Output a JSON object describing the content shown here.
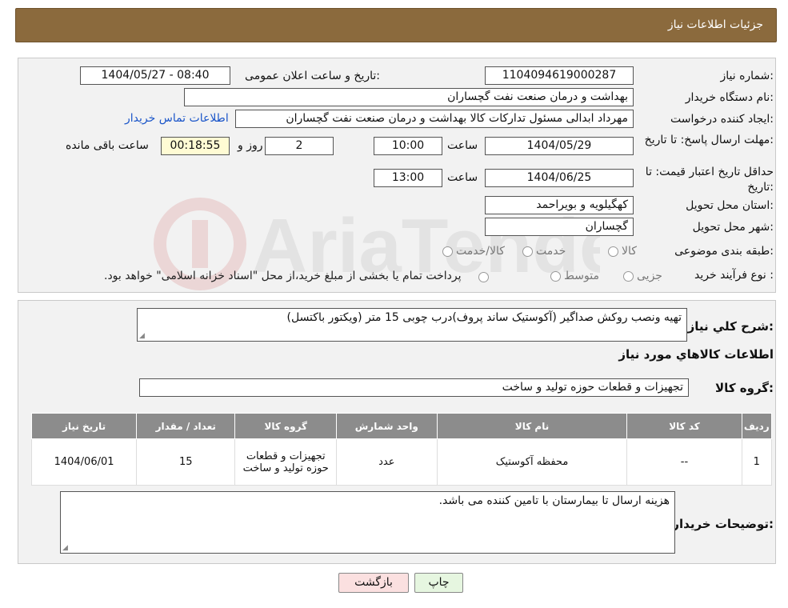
{
  "header": {
    "title": "جزئیات اطلاعات نیاز"
  },
  "form": {
    "need_number_label": "شماره نیاز:",
    "need_number": "1104094619000287",
    "announce_label": "تاریخ و ساعت اعلان عمومی:",
    "announce_value": "1404/05/27 - 08:40",
    "buyer_label": "نام دستگاه خریدار:",
    "buyer_value": "بهداشت و درمان صنعت نفت گچساران",
    "creator_label": "ایجاد کننده درخواست:",
    "creator_value": "مهرداد ابدالی مسئول تدارکات کالا  بهداشت و درمان صنعت نفت گچساران",
    "contact_link": "اطلاعات تماس خریدار",
    "deadline_label": "مهلت ارسال پاسخ: تا تاریخ:",
    "deadline_date": "1404/05/29",
    "time_label": "ساعت",
    "deadline_time": "10:00",
    "days_value": "2",
    "days_label": "روز و",
    "remaining_time": "00:18:55",
    "remaining_label": "ساعت باقی مانده",
    "validity_label": "حداقل تاریخ اعتبار قیمت: تا تاریخ:",
    "validity_date": "1404/06/25",
    "validity_time": "13:00",
    "province_label": "استان محل تحویل:",
    "province_value": "کهگیلویه و بویراحمد",
    "city_label": "شهر محل تحویل:",
    "city_value": "گچساران",
    "category_label": "طبقه بندی موضوعی:",
    "category_options": [
      "کالا",
      "خدمت",
      "کالا/خدمت"
    ],
    "process_label": "نوع فرآیند خرید :",
    "process_options": [
      "جزیی",
      "متوسط"
    ],
    "process_note": "پرداخت تمام یا بخشی از مبلغ خرید،از محل \"اسناد خزانه اسلامی\" خواهد بود."
  },
  "details": {
    "summary_label": "شرح کلي نياز:",
    "summary_value": "تهیه ونصب روکش صداگیر (آکوستیک ساند پروف)درب چوبی 15 متر (ویکتور باکتسل)",
    "goods_info_title": "اطلاعات کالاهاي مورد نياز",
    "goods_group_label": "گروه کالا:",
    "goods_group_value": "تجهیزات و قطعات حوزه تولید و ساخت",
    "table": {
      "headers": [
        "رديف",
        "کد کالا",
        "نام کالا",
        "واحد شمارش",
        "گروه کالا",
        "تعداد / مقدار",
        "تاريخ نياز"
      ],
      "rows": [
        [
          "1",
          "--",
          "محفظه آکوستیک",
          "عدد",
          "تجهیزات و قطعات حوزه تولید و ساخت",
          "15",
          "1404/06/01"
        ]
      ]
    },
    "buyer_notes_label": "توضیحات خریدار:",
    "buyer_notes_value": "هزینه ارسال تا بیمارستان با تامین کننده می باشد."
  },
  "buttons": {
    "print": "چاپ",
    "back": "بازگشت"
  },
  "watermark": {
    "text": "AriaTender.neT"
  },
  "colors": {
    "header_bg": "#8b6a3d",
    "table_header_bg": "#8c8c8c",
    "link": "#1a55c9",
    "remaining_bg": "#fffbd4",
    "back_button_bg": "#fbe0e0",
    "print_button_bg": "#e6f6e0"
  }
}
